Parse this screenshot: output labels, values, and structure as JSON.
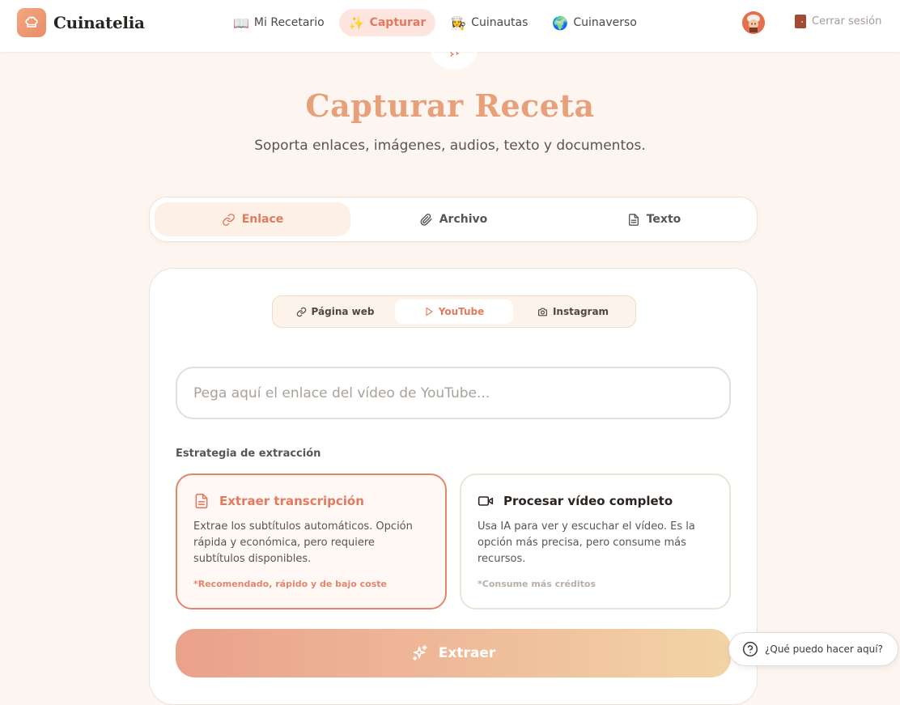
{
  "brand": {
    "name": "Cuinatelia"
  },
  "nav": {
    "items": [
      {
        "emoji": "📖",
        "label": "Mi Recetario"
      },
      {
        "emoji": "✨",
        "label": "Capturar"
      },
      {
        "emoji": "👩‍🍳",
        "label": "Cuinautas"
      },
      {
        "emoji": "🌍",
        "label": "Cuinaverso"
      }
    ],
    "active": "Capturar"
  },
  "user": {
    "logout_label": "Cerrar sesión"
  },
  "hero": {
    "title": "Capturar Receta",
    "subtitle": "Soporta enlaces, imágenes, audios, texto y documentos."
  },
  "main_tabs": [
    {
      "label": "Enlace",
      "icon": "link-icon",
      "active": true
    },
    {
      "label": "Archivo",
      "icon": "paperclip-icon",
      "active": false
    },
    {
      "label": "Texto",
      "icon": "document-icon",
      "active": false
    }
  ],
  "source_tabs": [
    {
      "label": "Página web",
      "icon": "link-icon",
      "active": false
    },
    {
      "label": "YouTube",
      "icon": "play-icon",
      "active": true
    },
    {
      "label": "Instagram",
      "icon": "camera-icon",
      "active": false
    }
  ],
  "url_input": {
    "value": "",
    "placeholder": "Pega aquí el enlace del vídeo de YouTube..."
  },
  "strategy": {
    "label": "Estrategia de extracción",
    "options": [
      {
        "title": "Extraer transcripción",
        "icon": "document-icon",
        "description": "Extrae los subtítulos automáticos. Opción rápida y económica, pero requiere subtítulos disponibles.",
        "note": "*Recomendado, rápido y de bajo coste",
        "selected": true
      },
      {
        "title": "Procesar vídeo completo",
        "icon": "video-camera-icon",
        "description": "Usa IA para ver y escuchar el vídeo. Es la opción más precisa, pero consume más recursos.",
        "note": "*Consume más créditos",
        "selected": false
      }
    ]
  },
  "extract_button": {
    "label": "Extraer",
    "icon": "sparkles-icon"
  },
  "help": {
    "label": "¿Qué puedo hacer aquí?",
    "icon": "question-circle-icon"
  },
  "colors": {
    "accent": "#e07b5f",
    "background": "#fdf5ef",
    "title": "#e8a07a",
    "button_gradient_start": "#eaa18c",
    "button_gradient_end": "#f3d3a6"
  }
}
